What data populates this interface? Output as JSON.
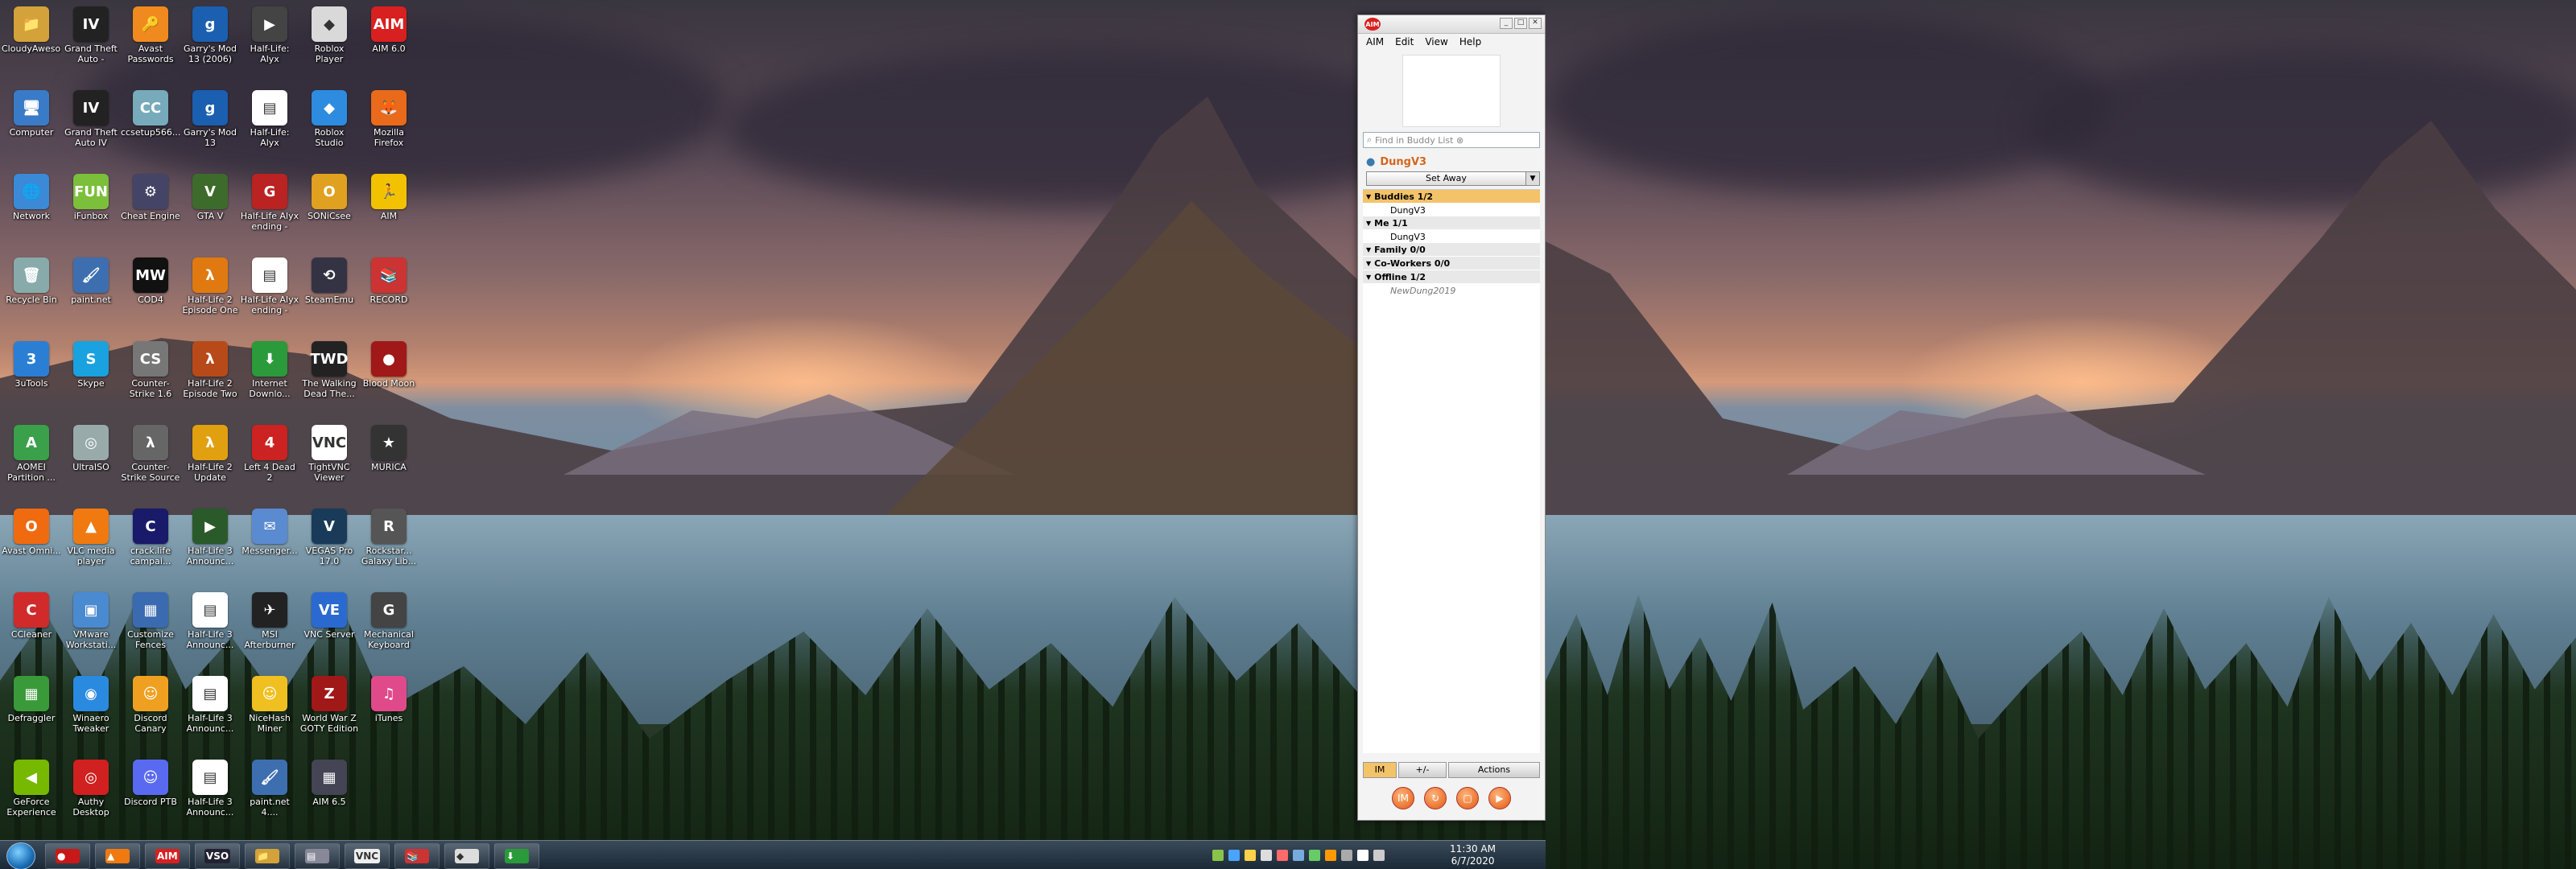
{
  "desktop": {
    "icons": [
      {
        "label": "CloudyAwesome",
        "text": "📁",
        "color": "#d4a23a"
      },
      {
        "label": "Grand Theft Auto - Episodes",
        "text": "IV",
        "color": "#222"
      },
      {
        "label": "Avast Passwords",
        "text": "🔑",
        "color": "#f08a1e"
      },
      {
        "label": "Garry's Mod 13 (2006)",
        "text": "g",
        "color": "#1a5fb0"
      },
      {
        "label": "Half-Life: Alyx Announcement...",
        "text": "▶",
        "color": "#444"
      },
      {
        "label": "Roblox Player",
        "text": "◆",
        "color": "#d9d9d9"
      },
      {
        "label": "AIM 6.0",
        "text": "AIM",
        "color": "#d82020"
      },
      {
        "label": "Computer",
        "text": "🖥",
        "color": "#3a7bc8"
      },
      {
        "label": "Grand Theft Auto IV",
        "text": "IV",
        "color": "#222"
      },
      {
        "label": "ccsetup566...",
        "text": "CC",
        "color": "#7ab"
      },
      {
        "label": "Garry's Mod 13",
        "text": "g",
        "color": "#1a5fb0"
      },
      {
        "label": "Half-Life: Alyx Announcem...",
        "text": "▤",
        "color": "#fff"
      },
      {
        "label": "Roblox Studio",
        "text": "◆",
        "color": "#2d8ce0"
      },
      {
        "label": "Mozilla Firefox",
        "text": "🦊",
        "color": "#e86a1a"
      },
      {
        "label": "Network",
        "text": "🌐",
        "color": "#3a8ad8"
      },
      {
        "label": "iFunbox",
        "text": "FUN",
        "color": "#7bbf3a"
      },
      {
        "label": "Cheat Engine",
        "text": "⚙",
        "color": "#446"
      },
      {
        "label": "GTA V",
        "text": "V",
        "color": "#3d6b2b"
      },
      {
        "label": "Half-Life Alyx ending - full...",
        "text": "G",
        "color": "#b22"
      },
      {
        "label": "SONiCsee",
        "text": "O",
        "color": "#e0a020"
      },
      {
        "label": "AIM",
        "text": "🏃",
        "color": "#f2c200"
      },
      {
        "label": "Recycle Bin",
        "text": "🗑",
        "color": "#8aa"
      },
      {
        "label": "paint.net",
        "text": "🖌",
        "color": "#3d6fb0"
      },
      {
        "label": "COD4",
        "text": "MW",
        "color": "#111"
      },
      {
        "label": "Half-Life 2 Episode One",
        "text": "λ",
        "color": "#e07a10"
      },
      {
        "label": "Half-Life Alyx ending - full...",
        "text": "▤",
        "color": "#fff"
      },
      {
        "label": "SteamEmu",
        "text": "⟲",
        "color": "#334"
      },
      {
        "label": "RECORD",
        "text": "📚",
        "color": "#c33"
      },
      {
        "label": "3uTools",
        "text": "3",
        "color": "#2a7fd4"
      },
      {
        "label": "Skype",
        "text": "S",
        "color": "#1aa1e0"
      },
      {
        "label": "Counter-Strike 1.6",
        "text": "CS",
        "color": "#777"
      },
      {
        "label": "Half-Life 2 Episode Two",
        "text": "λ",
        "color": "#b84a1a"
      },
      {
        "label": "Internet Downlo...",
        "text": "⬇",
        "color": "#2a9a3a"
      },
      {
        "label": "The Walking Dead The...",
        "text": "TWD",
        "color": "#222"
      },
      {
        "label": "Blood Moon",
        "text": "●",
        "color": "#a01818"
      },
      {
        "label": "AOMEI Partition ...",
        "text": "A",
        "color": "#3aa04a"
      },
      {
        "label": "UltraISO",
        "text": "◎",
        "color": "#9aa"
      },
      {
        "label": "Counter-Strike Source",
        "text": "λ",
        "color": "#666"
      },
      {
        "label": "Half-Life 2 Update",
        "text": "λ",
        "color": "#e0a010"
      },
      {
        "label": "Left 4 Dead 2",
        "text": "4",
        "color": "#c22"
      },
      {
        "label": "TightVNC Viewer",
        "text": "VNC",
        "color": "#fff"
      },
      {
        "label": "MURICA",
        "text": "★",
        "color": "#333"
      },
      {
        "label": "Avast Omni...",
        "text": "O",
        "color": "#f06a10"
      },
      {
        "label": "VLC media player",
        "text": "▲",
        "color": "#f07a10"
      },
      {
        "label": "crack.life campai...",
        "text": "C",
        "color": "#1a1a6a"
      },
      {
        "label": "Half-Life 3 Announc...",
        "text": "▶",
        "color": "#2a5a2a"
      },
      {
        "label": "Messenger...",
        "text": "✉",
        "color": "#5a8ad0"
      },
      {
        "label": "VEGAS Pro 17.0",
        "text": "V",
        "color": "#1a3a5a"
      },
      {
        "label": "Rockstar... Galaxy Lib...",
        "text": "R",
        "color": "#555"
      },
      {
        "label": "CCleaner",
        "text": "C",
        "color": "#d02a2a"
      },
      {
        "label": "VMware Workstati...",
        "text": "▣",
        "color": "#4a8ad0"
      },
      {
        "label": "Customize Fences",
        "text": "▦",
        "color": "#3a6ab0"
      },
      {
        "label": "Half-Life 3 Announc...",
        "text": "▤",
        "color": "#fff"
      },
      {
        "label": "MSI Afterburner",
        "text": "✈",
        "color": "#222"
      },
      {
        "label": "VNC Server",
        "text": "VE",
        "color": "#2a6ad0"
      },
      {
        "label": "Mechanical Keyboard",
        "text": "G",
        "color": "#444"
      },
      {
        "label": "Defraggler",
        "text": "▦",
        "color": "#3a9a3a"
      },
      {
        "label": "Winaero Tweaker",
        "text": "◉",
        "color": "#2a8ae0"
      },
      {
        "label": "Discord Canary",
        "text": "☺",
        "color": "#f0a020"
      },
      {
        "label": "Half-Life 3 Announc...",
        "text": "▤",
        "color": "#fff"
      },
      {
        "label": "NiceHash Miner",
        "text": "☺",
        "color": "#f0c020"
      },
      {
        "label": "World War Z GOTY Edition",
        "text": "Z",
        "color": "#a01818"
      },
      {
        "label": "iTunes",
        "text": "♫",
        "color": "#e04a8a"
      },
      {
        "label": "GeForce Experience",
        "text": "◀",
        "color": "#76b900"
      },
      {
        "label": "Authy Desktop",
        "text": "◎",
        "color": "#d02020"
      },
      {
        "label": "Discord PTB",
        "text": "☺",
        "color": "#5a6af0"
      },
      {
        "label": "Half-Life 3 Announc...",
        "text": "▤",
        "color": "#fff"
      },
      {
        "label": "paint.net 4....",
        "text": "🖌",
        "color": "#3d6fb0"
      },
      {
        "label": "AIM 6.5",
        "text": "▦",
        "color": "#445"
      }
    ]
  },
  "taskbar": {
    "items": [
      {
        "label": "",
        "text": "●",
        "color": "#c81818"
      },
      {
        "label": "",
        "text": "▲",
        "color": "#f07a10"
      },
      {
        "label": "AIM",
        "text": "AIM",
        "color": "#d82020"
      },
      {
        "label": "",
        "text": "VSO",
        "color": "#223"
      },
      {
        "label": "",
        "text": "📁",
        "color": "#d4a23a"
      },
      {
        "label": "",
        "text": "▤",
        "color": "#889"
      },
      {
        "label": "",
        "text": "VNC",
        "color": "#eee"
      },
      {
        "label": "",
        "text": "📚",
        "color": "#c33"
      },
      {
        "label": "",
        "text": "◆",
        "color": "#ddd"
      },
      {
        "label": "",
        "text": "⬇",
        "color": "#2a9a3a"
      }
    ],
    "clock": {
      "time": "11:30 AM",
      "date": "6/7/2020"
    }
  },
  "aim": {
    "title_logo": "AIM",
    "menu": [
      "AIM",
      "Edit",
      "View",
      "Help"
    ],
    "search_placeholder": "Find in Buddy List ⊗",
    "screen_name": "DungV3",
    "status": "Set Away",
    "groups": [
      {
        "name": "Buddies 1/2",
        "selected": true,
        "buddies": [
          {
            "name": "DungV3",
            "offline": false
          }
        ]
      },
      {
        "name": "Me 1/1",
        "selected": false,
        "buddies": [
          {
            "name": "DungV3",
            "offline": false
          }
        ]
      },
      {
        "name": "Family 0/0",
        "selected": false,
        "buddies": []
      },
      {
        "name": "Co-Workers 0/0",
        "selected": false,
        "buddies": []
      },
      {
        "name": "Offline 1/2",
        "selected": false,
        "buddies": [
          {
            "name": "NewDung2019",
            "offline": true
          }
        ]
      }
    ],
    "bottom_buttons": [
      "IM",
      "+/-",
      "Actions"
    ],
    "bottom_icons": [
      "IM",
      "↻",
      "▢",
      "▶"
    ]
  }
}
